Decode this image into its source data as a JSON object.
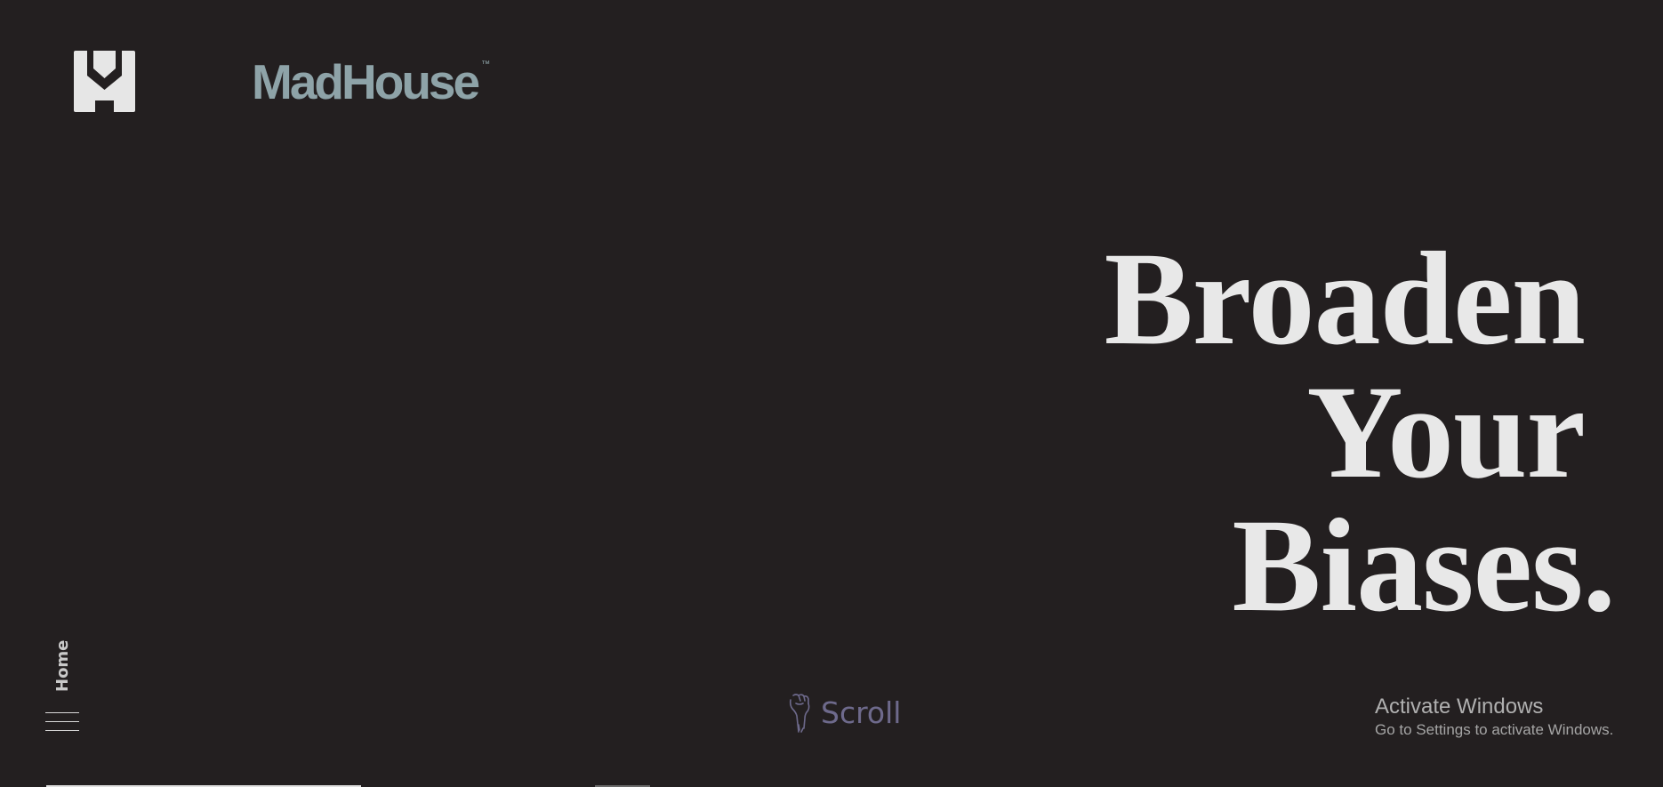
{
  "brand": {
    "name": "MadHouse",
    "trademark": "™",
    "logo_icon": "madhouse-m-logo"
  },
  "hero": {
    "lines": [
      "Broaden",
      "Your",
      "Biases."
    ]
  },
  "nav": {
    "current_page": "Home",
    "menu_icon": "hamburger-icon"
  },
  "scroll": {
    "label": "Scroll",
    "icon": "pointing-hand-icon"
  },
  "system_overlay": {
    "title": "Activate Windows",
    "message": "Go to Settings to activate Windows."
  },
  "progress": {
    "value": 0.2
  },
  "colors": {
    "background": "#231f20",
    "headline": "#e8e8e8",
    "brand": "#8ea3a8",
    "scroll_text": "#6e6a8c"
  }
}
